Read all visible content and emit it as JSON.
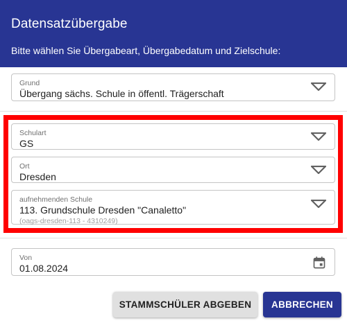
{
  "dialog": {
    "title": "Datensatzübergabe",
    "subtitle": "Bitte wählen Sie Übergabeart, Übergabedatum und Zielschule:"
  },
  "fields": {
    "grund": {
      "label": "Grund",
      "value": "Übergang sächs. Schule in öffentl. Trägerschaft",
      "icon": "chevron-down-icon"
    },
    "schulart": {
      "label": "Schulart",
      "value": "GS",
      "icon": "chevron-down-icon"
    },
    "ort": {
      "label": "Ort",
      "value": "Dresden",
      "icon": "chevron-down-icon"
    },
    "schule": {
      "label": "aufnehmenden Schule",
      "value": "113. Grundschule Dresden \"Canaletto\"",
      "hint": "(oags-dresden-113 - 4310249)",
      "icon": "chevron-down-icon"
    },
    "von": {
      "label": "Von",
      "value": "01.08.2024",
      "icon": "calendar-icon"
    }
  },
  "actions": {
    "submit_label": "STAMMSCHÜLER ABGEBEN",
    "cancel_label": "ABBRECHEN"
  },
  "colors": {
    "primary": "#283593",
    "highlight": "#ff0000"
  }
}
